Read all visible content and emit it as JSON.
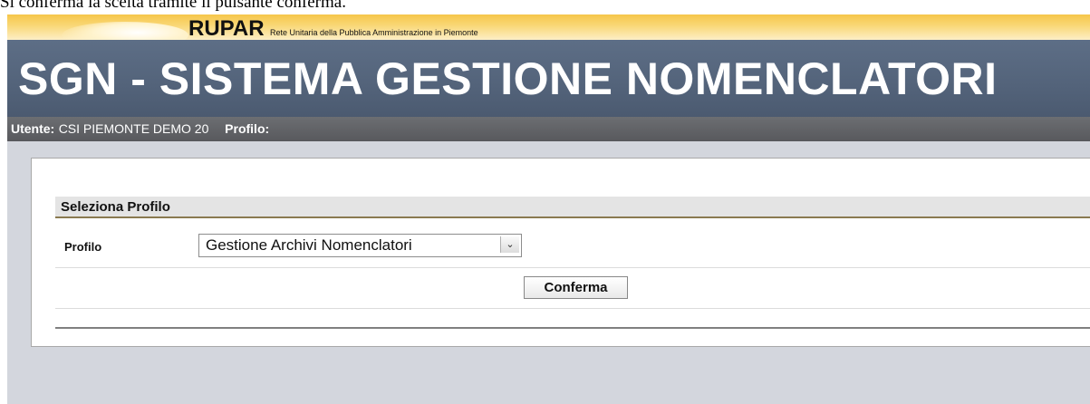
{
  "caption": "Si conferma la scelta tramite il pulsante conferma.",
  "banner": {
    "brand": "RUPAR",
    "brand_subtitle": "Rete Unitaria della Pubblica Amministrazione in Piemonte"
  },
  "app_title": "SGN - SISTEMA GESTIONE NOMENCLATORI",
  "user_bar": {
    "user_label": "Utente:",
    "user_value": "CSI PIEMONTE DEMO 20",
    "profile_label": "Profilo:",
    "profile_value": ""
  },
  "section": {
    "title": "Seleziona Profilo",
    "profile_field_label": "Profilo",
    "profile_selected": "Gestione Archivi Nomenclatori",
    "confirm_button": "Conferma"
  },
  "icons": {
    "dropdown": "chevron-down-icon"
  },
  "colors": {
    "banner_gold": "#f6c64a",
    "title_band": "#56667d",
    "user_band": "#616266",
    "content_bg": "#d3d6dd",
    "section_underline": "#8a7a50"
  }
}
